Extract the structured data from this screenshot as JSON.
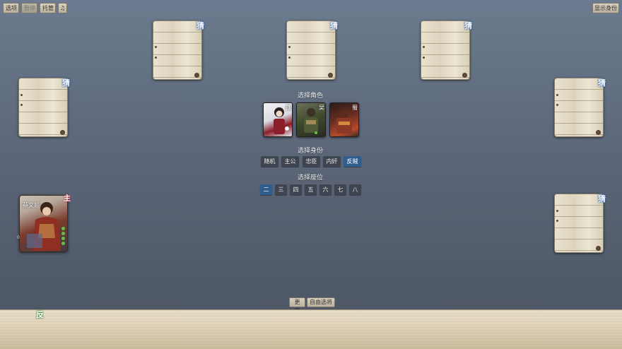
{
  "toolbar": {
    "options": "选项",
    "pause": "暂停",
    "auto": "托管",
    "music_icon": "♫",
    "show_identity": "显示身份"
  },
  "seats": [
    {
      "guess": "猜"
    },
    {
      "guess": "猜"
    },
    {
      "guess": "猜"
    },
    {
      "guess": "猜"
    },
    {
      "guess": "猜"
    },
    {
      "guess": "猜"
    }
  ],
  "choose_character": {
    "title": "选择角色",
    "cards": [
      {
        "kingdom": "魏",
        "color": "#e8e8ef",
        "accent": "#8b1e2a"
      },
      {
        "kingdom": "吴",
        "color": "#4c5a2c",
        "accent": "#2b2a2a"
      },
      {
        "kingdom": "蜀",
        "color": "#6b2d20",
        "accent": "#b94a2b"
      }
    ]
  },
  "choose_identity": {
    "title": "选择身份",
    "options": [
      "随机",
      "主公",
      "忠臣",
      "内奸",
      "反贼"
    ],
    "selected": "反贼"
  },
  "choose_seat": {
    "title": "选择座位",
    "options": [
      "二",
      "三",
      "四",
      "五",
      "六",
      "七",
      "八"
    ],
    "selected": "二"
  },
  "player": {
    "name": "蔡文姬",
    "role_badge": "主",
    "hp": 4,
    "hand_count": "0"
  },
  "bottom_buttons": {
    "replace": "更换",
    "free_choose": "自由选将"
  },
  "my_identity": "反",
  "colors": {
    "selected_button": "#2f5d8e",
    "button": "#3e4450",
    "hp": "#67c13f"
  }
}
